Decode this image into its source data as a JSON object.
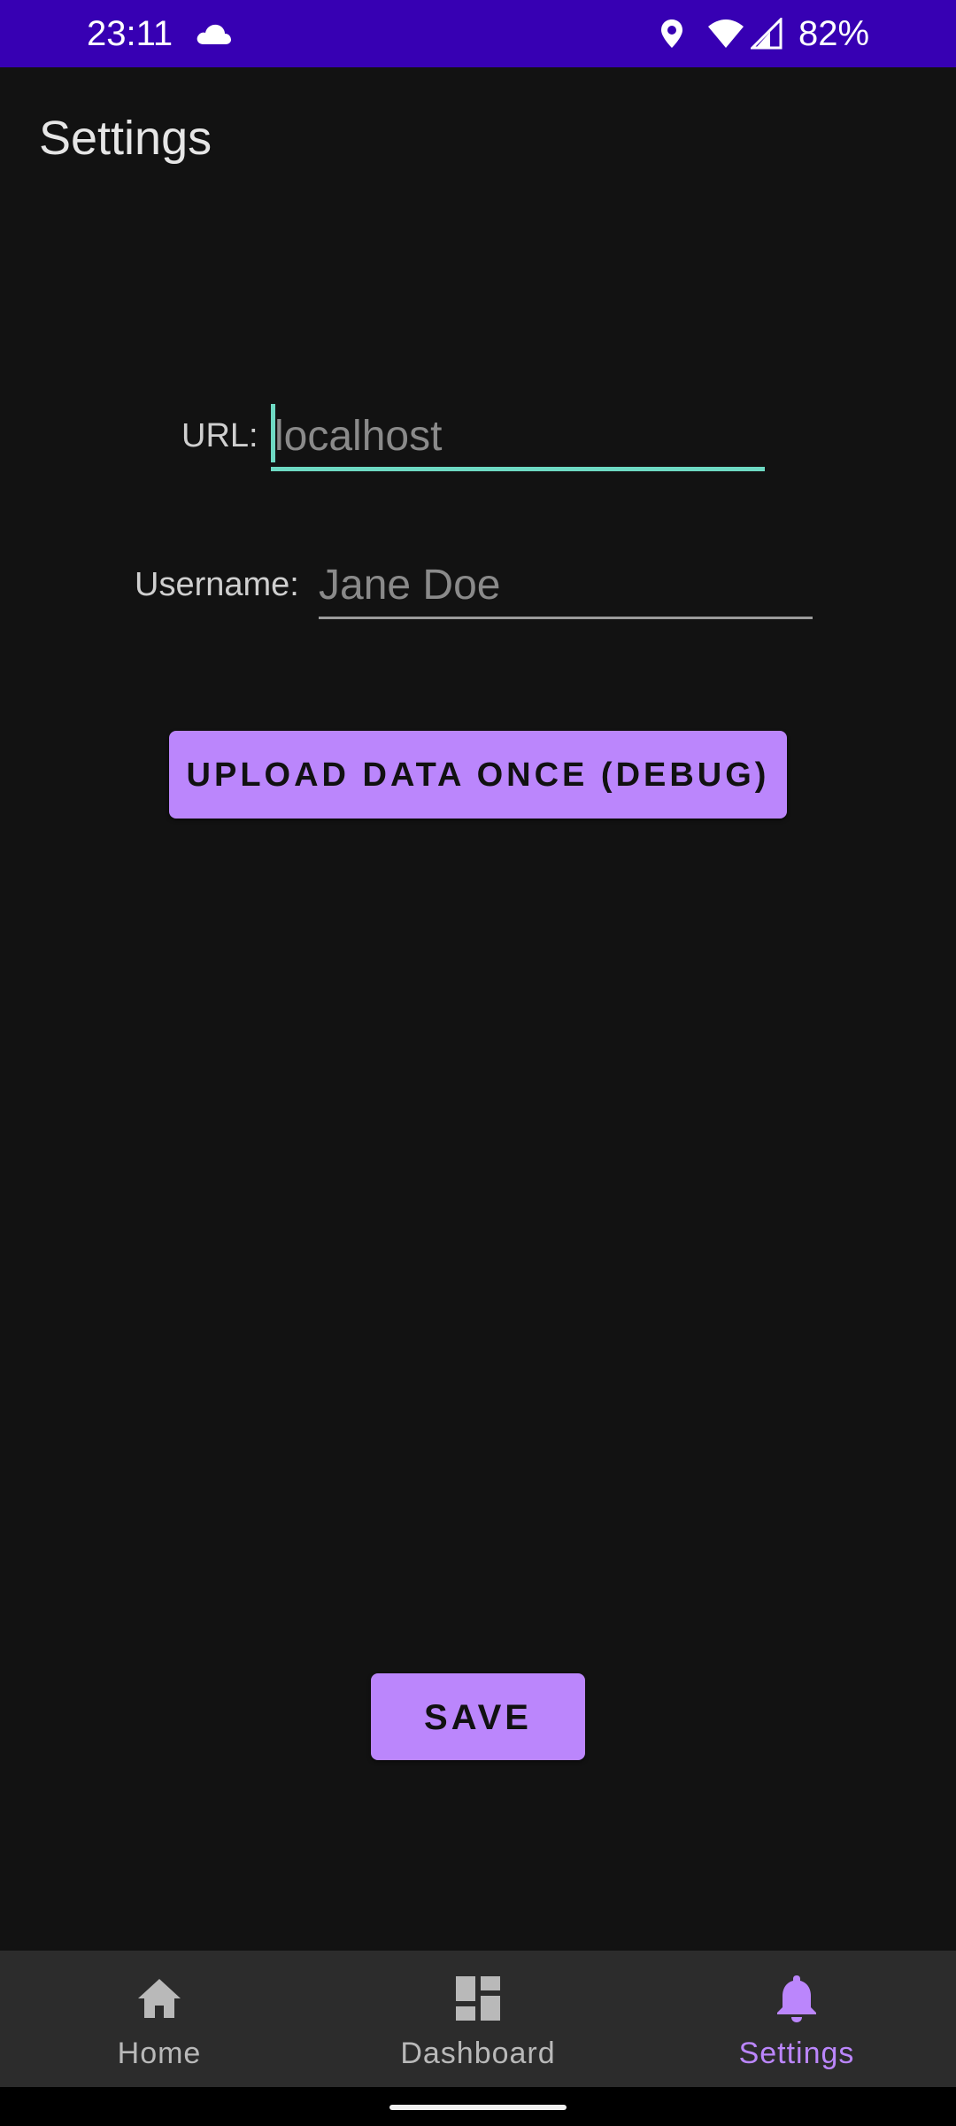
{
  "status_bar": {
    "time": "23:11",
    "battery": "82%",
    "icons": [
      "cloud-icon",
      "location-icon",
      "wifi-icon",
      "signal-icon"
    ]
  },
  "app": {
    "title": "Settings"
  },
  "form": {
    "url": {
      "label": "URL:",
      "value": "",
      "placeholder": "localhost"
    },
    "username": {
      "label": "Username:",
      "value": "",
      "placeholder": "Jane Doe"
    }
  },
  "buttons": {
    "upload_label": "UPLOAD DATA ONCE (DEBUG)",
    "save_label": "SAVE"
  },
  "bottom_nav": {
    "items": [
      {
        "label": "Home",
        "icon": "home-icon",
        "selected": false
      },
      {
        "label": "Dashboard",
        "icon": "dashboard-icon",
        "selected": false
      },
      {
        "label": "Settings",
        "icon": "bell-icon",
        "selected": true
      }
    ]
  },
  "colors": {
    "status_bar": "#3700b3",
    "background": "#121212",
    "accent": "#bb86fc",
    "focus": "#6ed9c3",
    "nav_background": "#2c2c2c"
  }
}
